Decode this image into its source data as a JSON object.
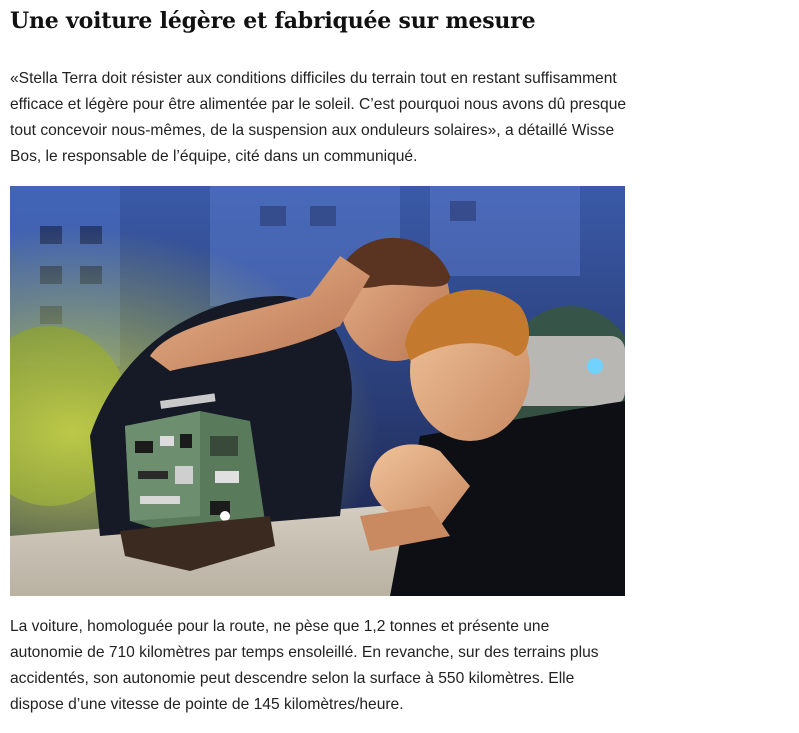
{
  "article": {
    "title": "Une voiture légère et fabriquée sur mesure",
    "paragraph_1": "«Stella Terra doit résister aux conditions difficiles du terrain tout en restant suffisamment efficace et légère pour être alimentée par le soleil. C’est pourquoi nous avons dû presque tout concevoir nous-mêmes, de la suspension aux onduleurs solaires», a détaillé Wisse Bos, le responsable de l’équipe, cité dans un communiqué.",
    "paragraph_2": "La voiture, homologuée pour la route, ne pèse que 1,2 tonnes et présente une autonomie de 710 kilomètres par temps ensoleillé. En revanche, sur des terrains plus accidentés, son autonomie peut descendre selon la surface à 550 kilomètres. Elle dispose d’une vitesse de pointe de 145 kilomètres/heure."
  }
}
